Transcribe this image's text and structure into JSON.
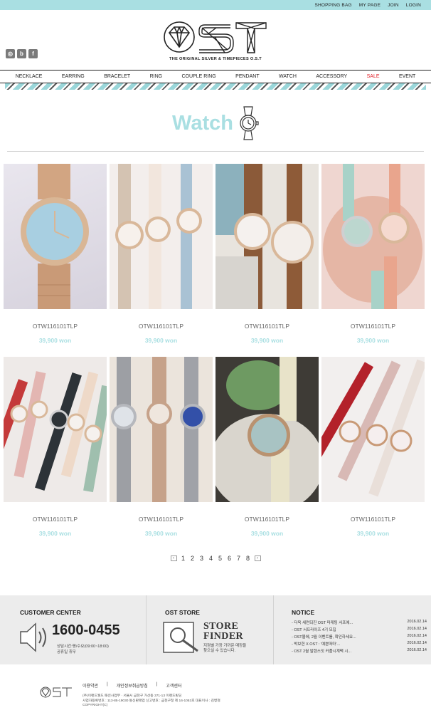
{
  "topbar": {
    "links": [
      "SHOPPING BAG",
      "MY PAGE",
      "JOIN",
      "LOGIN"
    ]
  },
  "brand": {
    "logo": "OST",
    "tagline": "THE ORIGINAL SILVER & TIMEPIECES O.S.T"
  },
  "social": [
    "instagram-icon",
    "blog-icon",
    "facebook-icon"
  ],
  "nav": [
    "NECKLACE",
    "EARRING",
    "BRACELET",
    "RING",
    "COUPLE RING",
    "PENDANT",
    "WATCH",
    "ACCESSORY",
    "SALE",
    "EVENT"
  ],
  "page": {
    "title": "Watch"
  },
  "products": [
    {
      "name": "OTW116101TLP",
      "price": "39,900 won"
    },
    {
      "name": "OTW116101TLP",
      "price": "39,900 won"
    },
    {
      "name": "OTW116101TLP",
      "price": "39,900 won"
    },
    {
      "name": "OTW116101TLP",
      "price": "39,900 won"
    },
    {
      "name": "OTW116101TLP",
      "price": "39,900 won"
    },
    {
      "name": "OTW116101TLP",
      "price": "39,900 won"
    },
    {
      "name": "OTW116101TLP",
      "price": "39,900 won"
    },
    {
      "name": "OTW116101TLP",
      "price": "39,900 won"
    }
  ],
  "pagination": {
    "pages": [
      "1",
      "2",
      "3",
      "4",
      "5",
      "6",
      "7",
      "8"
    ],
    "prev": "‹",
    "next": "›"
  },
  "footer": {
    "customer_center": {
      "title": "CUSTOMER CENTER",
      "phone": "1600-0455",
      "hours_1": "상담시간:평/수요(09:00~18:00)",
      "hours_2": "공휴일 휴무"
    },
    "store": {
      "title": "OST STORE",
      "line1": "STORE",
      "line2": "FINDER",
      "desc_1": "지점별 가장 가까운 매장을",
      "desc_2": "찾으실 수 있습니다."
    },
    "notice": {
      "title": "NOTICE",
      "items": [
        {
          "text": "- 더욱 세련되진 OST 마케팅 서프에...",
          "date": "2016.02.14"
        },
        {
          "text": "- OST 서프라이즈 4기 모집",
          "date": "2016.02.14"
        },
        {
          "text": "- OST몰에, 2월 이벤트를, 확인하세요...",
          "date": "2016.02.14"
        },
        {
          "text": "- 박보현 X OST : '예쁜떠마'...",
          "date": "2016.02.14"
        },
        {
          "text": "- OST 2월 발렌스잇 커플시계팩 시...",
          "date": "2016.02.14"
        }
      ]
    },
    "links": [
      "이용약관",
      "|",
      "개인정보취급방침",
      "|",
      "고객센터"
    ],
    "info_1": "(주)이랜드월드 패션사업부 · 서울시 금천구 가산동 371-13 이랜드빌딩",
    "info_2": "사업자등록번호 : 113-85-19030 통신판매업 신고번호 : 금천구청 제 16-1053호 대표이사 : 김병철",
    "info_3": "COPYRIGHT(C)"
  }
}
